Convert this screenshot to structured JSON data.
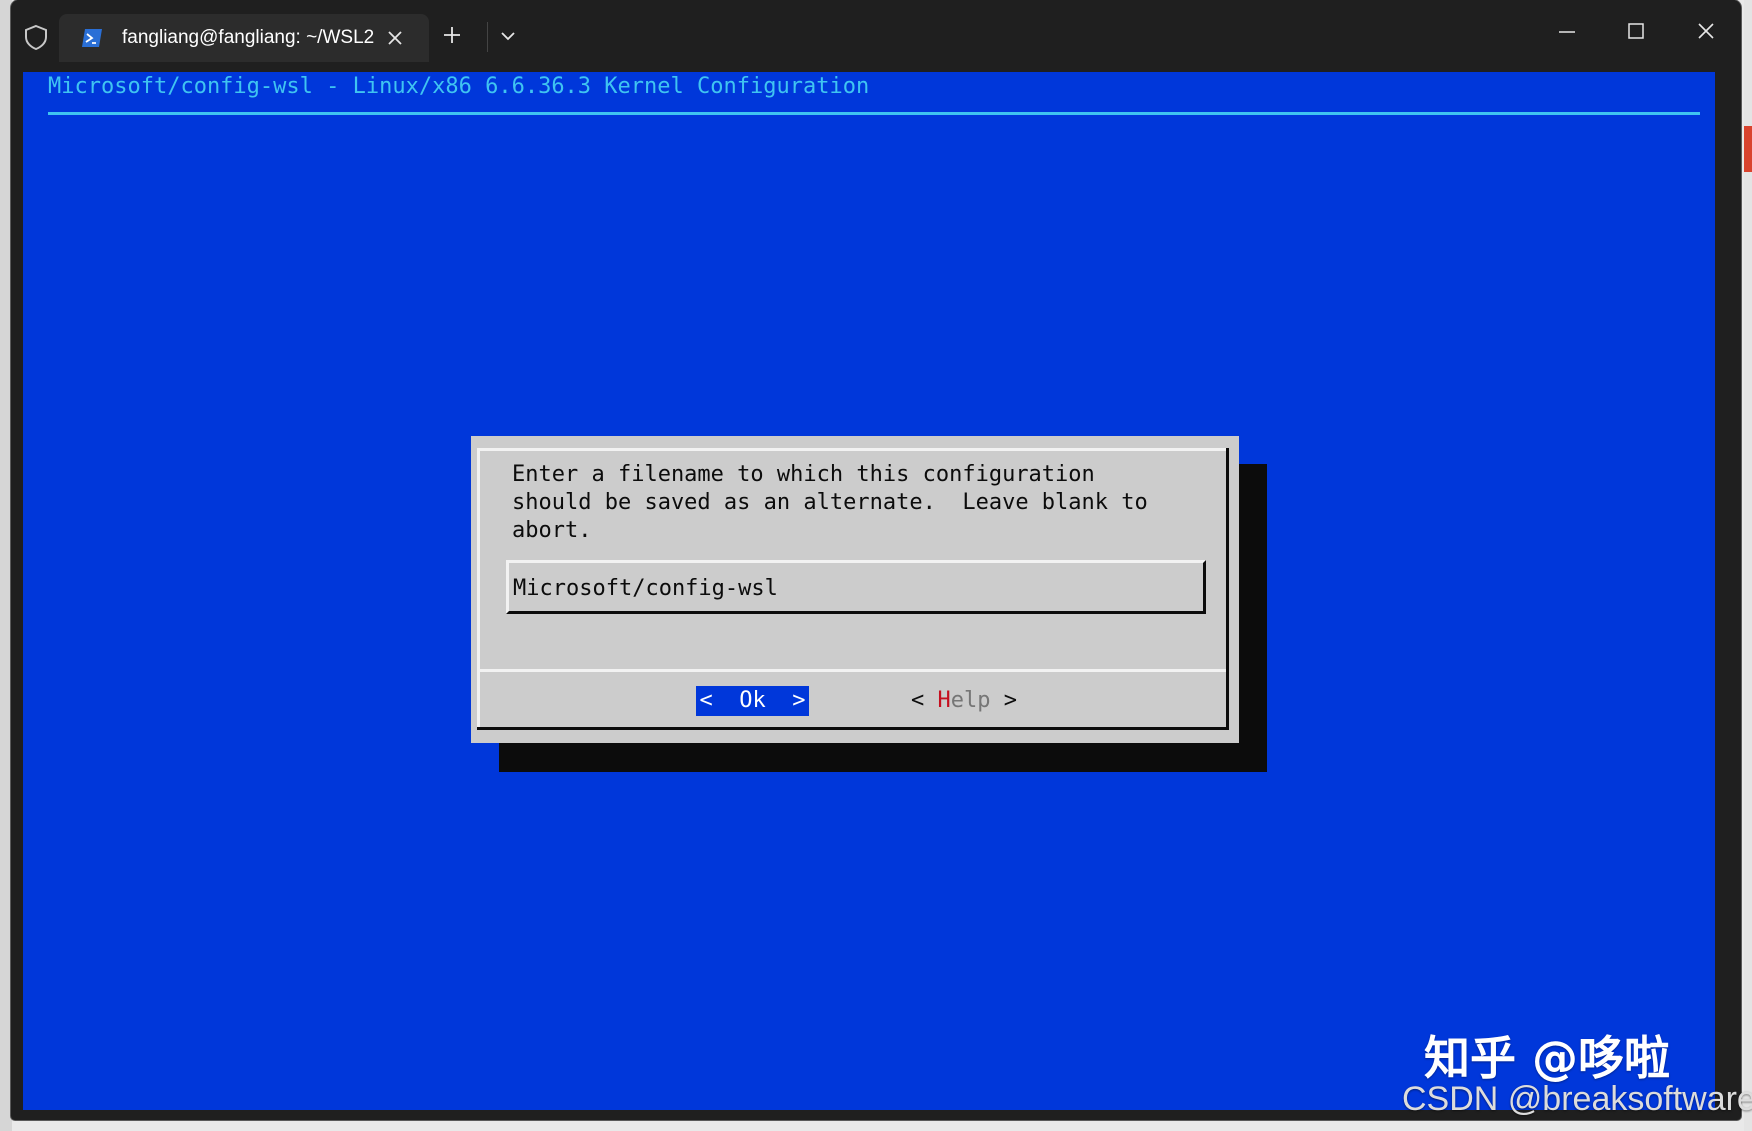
{
  "window": {
    "tab_title": "fangliang@fangliang: ~/WSL2",
    "icons": {
      "shield": "shield-icon",
      "tab": "powershell-icon",
      "tab_close": "close-icon",
      "new_tab": "plus-icon",
      "dropdown": "chevron-down-icon",
      "minimize": "minimize-icon",
      "maximize": "maximize-icon",
      "close": "close-icon"
    }
  },
  "terminal": {
    "header": "Microsoft/config-wsl - Linux/x86 6.6.36.3 Kernel Configuration",
    "dialog": {
      "message_lines": [
        "Enter a filename to which this configuration",
        "should be saved as an alternate.  Leave blank to",
        "abort."
      ],
      "input_value": "Microsoft/config-wsl",
      "ok_label": "<  Ok  >",
      "help_prefix": "< ",
      "help_hotkey": "H",
      "help_rest": "elp",
      "help_suffix": " >"
    },
    "colors": {
      "background": "#0037da",
      "header_text": "#3fc4f1",
      "dialog_bg": "#cccccc",
      "shadow": "#0c0c0c",
      "hotkey": "#c50f1f"
    }
  },
  "watermarks": {
    "zhihu": "知乎 @哆啦",
    "csdn": "CSDN @breaksoftware"
  }
}
